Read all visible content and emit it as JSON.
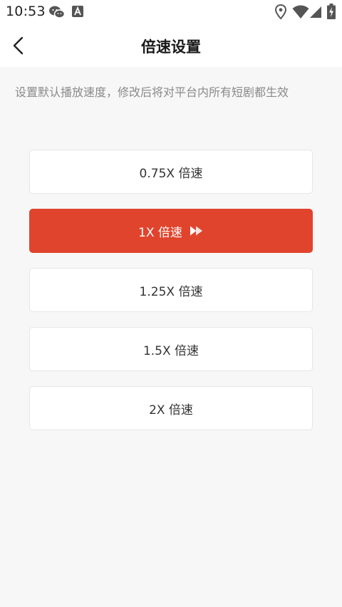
{
  "status_bar": {
    "time": "10:53",
    "icons": [
      "wechat-icon",
      "a-notification-icon",
      "location-icon",
      "wifi-icon",
      "signal-icon",
      "battery-charging-icon"
    ]
  },
  "header": {
    "back_icon": "chevron-left-icon",
    "title": "倍速设置"
  },
  "description": "设置默认播放速度，修改后将对平台内所有短剧都生效",
  "speed_options": [
    {
      "label": "0.75X 倍速",
      "selected": false
    },
    {
      "label": "1X 倍速",
      "selected": true
    },
    {
      "label": "1.25X 倍速",
      "selected": false
    },
    {
      "label": "1.5X 倍速",
      "selected": false
    },
    {
      "label": "2X 倍速",
      "selected": false
    }
  ],
  "colors": {
    "accent": "#e0442d",
    "background": "#f7f7f7",
    "card": "#ffffff",
    "description_text": "#8a8a8a"
  }
}
